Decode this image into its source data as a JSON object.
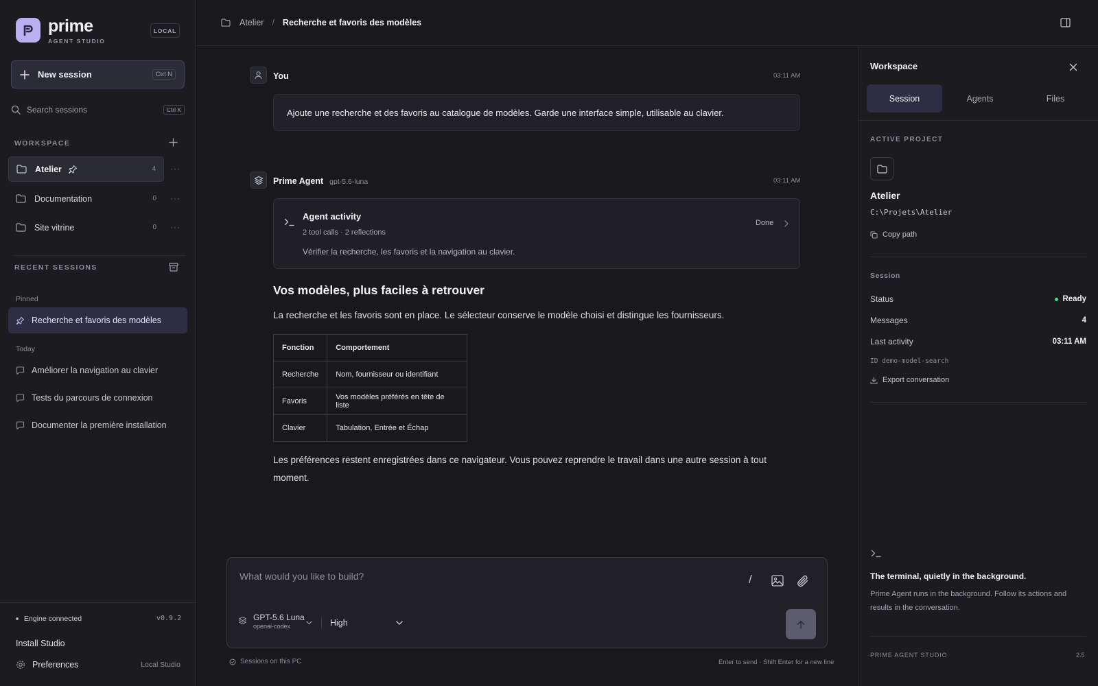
{
  "app": {
    "brand": "prime",
    "brand_sub": "AGENT STUDIO",
    "local_badge": "LOCAL"
  },
  "sidebar": {
    "new_session_label": "New session",
    "new_session_shortcut": "Ctrl N",
    "search_label": "Search sessions",
    "search_shortcut": "Ctrl K",
    "workspace_heading": "WORKSPACE",
    "workspace_items": [
      {
        "name": "Atelier",
        "count": "4"
      },
      {
        "name": "Documentation",
        "count": "0"
      },
      {
        "name": "Site vitrine",
        "count": "0"
      }
    ],
    "recent_heading": "RECENT SESSIONS",
    "pinned_label": "Pinned",
    "pinned_session": "Recherche et favoris des modèles",
    "today_label": "Today",
    "today_sessions": [
      "Améliorer la navigation au clavier",
      "Tests du parcours de connexion",
      "Documenter la première installation"
    ],
    "engine_status": "Engine connected",
    "version": "v0.9.2",
    "install_label": "Install Studio",
    "preferences_label": "Preferences",
    "preferences_meta": "Local Studio"
  },
  "header": {
    "breadcrumb_root": "Atelier",
    "breadcrumb_sep": "/",
    "breadcrumb_current": "Recherche et favoris des modèles"
  },
  "chat": {
    "user_name": "You",
    "user_time": "03:11 AM",
    "user_message": "Ajoute une recherche et des favoris au catalogue de modèles. Garde une interface simple, utilisable au clavier.",
    "agent_name": "Prime Agent",
    "agent_model": "gpt-5.6-luna",
    "agent_time": "03:11 AM",
    "activity_title": "Agent activity",
    "activity_meta": "2 tool calls · 2 reflections",
    "activity_status": "Done",
    "activity_detail": "Vérifier la recherche, les favoris et la navigation au clavier.",
    "answer_heading": "Vos modèles, plus faciles à retrouver",
    "answer_intro": "La recherche et les favoris sont en place. Le sélecteur conserve le modèle choisi et distingue les fournisseurs.",
    "table_headers": [
      "Fonction",
      "Comportement"
    ],
    "table_rows": [
      [
        "Recherche",
        "Nom, fournisseur ou identifiant"
      ],
      [
        "Favoris",
        "Vos modèles préférés en tête de liste"
      ],
      [
        "Clavier",
        "Tabulation, Entrée et Échap"
      ]
    ],
    "answer_outro": "Les préférences restent enregistrées dans ce navigateur. Vous pouvez reprendre le travail dans une autre session à tout moment."
  },
  "composer": {
    "placeholder": "What would you like to build?",
    "slash": "/",
    "model_name": "GPT-5.6 Luna",
    "model_provider": "openai-codex",
    "effort": "High",
    "footer_left": "Sessions on this PC",
    "footer_right": "Enter to send · Shift Enter for a new line"
  },
  "panel": {
    "title": "Workspace",
    "tabs": [
      "Session",
      "Agents",
      "Files"
    ],
    "active_project_heading": "ACTIVE PROJECT",
    "project_name": "Atelier",
    "project_path": "C:\\Projets\\Atelier",
    "copy_path_label": "Copy path",
    "session_heading": "Session",
    "status_label": "Status",
    "status_value": "Ready",
    "messages_label": "Messages",
    "messages_value": "4",
    "last_activity_label": "Last activity",
    "last_activity_value": "03:11 AM",
    "session_id": "ID demo-model-search",
    "export_label": "Export conversation",
    "terminal_title": "The terminal, quietly in the background.",
    "terminal_desc": "Prime Agent runs in the background. Follow its actions and results in the conversation.",
    "footer_brand": "PRIME AGENT STUDIO",
    "footer_version": "2.5"
  },
  "colors": {
    "accent": "#b9b0f2",
    "background": "#18181d",
    "status_ready": "#4ade80"
  }
}
